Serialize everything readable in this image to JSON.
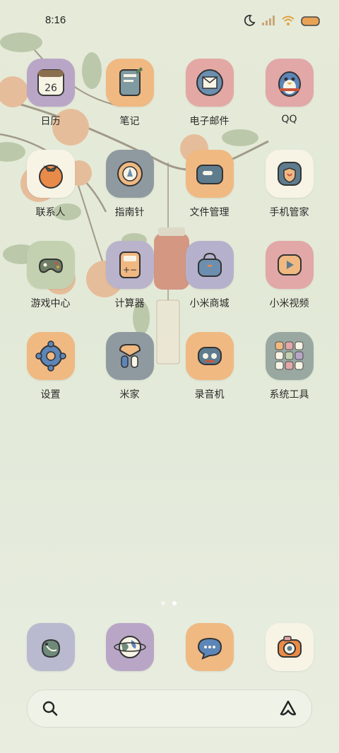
{
  "status_bar": {
    "time": "8:16"
  },
  "apps": [
    {
      "id": "calendar",
      "label": "日历",
      "bg": "#b9a6c7",
      "icon": "calendar-icon"
    },
    {
      "id": "notes",
      "label": "笔记",
      "bg": "#f0b982",
      "icon": "notes-icon"
    },
    {
      "id": "email",
      "label": "电子邮件",
      "bg": "#e4a8a4",
      "icon": "email-icon"
    },
    {
      "id": "qq",
      "label": "QQ",
      "bg": "#e2a7a7",
      "icon": "qq-penguin-icon"
    },
    {
      "id": "contacts",
      "label": "联系人",
      "bg": "#f7f4e6",
      "icon": "persimmon-icon"
    },
    {
      "id": "compass",
      "label": "指南针",
      "bg": "#8f9aa0",
      "icon": "compass-icon"
    },
    {
      "id": "files",
      "label": "文件管理",
      "bg": "#f0b982",
      "icon": "folder-icon"
    },
    {
      "id": "security",
      "label": "手机管家",
      "bg": "#f7f4e6",
      "icon": "shield-icon"
    },
    {
      "id": "game_center",
      "label": "游戏中心",
      "bg": "#c4d1b0",
      "icon": "gamepad-icon"
    },
    {
      "id": "calculator",
      "label": "计算器",
      "bg": "#b9b3cc",
      "icon": "calculator-icon"
    },
    {
      "id": "mi_store",
      "label": "小米商城",
      "bg": "#b5b1cc",
      "icon": "shopping-bag-icon"
    },
    {
      "id": "mi_video",
      "label": "小米视频",
      "bg": "#e2a7a7",
      "icon": "video-play-icon"
    },
    {
      "id": "settings",
      "label": "设置",
      "bg": "#f0b982",
      "icon": "gear-icon"
    },
    {
      "id": "mi_home",
      "label": "米家",
      "bg": "#8f9aa0",
      "icon": "home-icon"
    },
    {
      "id": "recorder",
      "label": "录音机",
      "bg": "#f0b982",
      "icon": "recorder-icon"
    },
    {
      "id": "system_tools",
      "label": "系统工具",
      "bg": "#9aa8a2",
      "icon": "folder-grid-icon"
    }
  ],
  "dock": [
    {
      "id": "phone",
      "bg": "#b9b9cf",
      "icon": "phone-icon"
    },
    {
      "id": "browser",
      "bg": "#b9a6c7",
      "icon": "globe-icon"
    },
    {
      "id": "messages",
      "bg": "#f0b982",
      "icon": "message-icon"
    },
    {
      "id": "camera",
      "bg": "#f7f4e6",
      "icon": "camera-icon"
    }
  ],
  "page_indicator": {
    "pages": 2,
    "current": 2
  }
}
